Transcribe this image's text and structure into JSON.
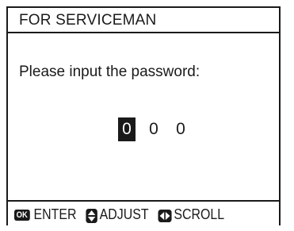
{
  "header": {
    "title": "FOR SERVICEMAN"
  },
  "main": {
    "prompt": "Please input the password:",
    "password_digits": [
      "0",
      "0",
      "0"
    ],
    "selected_digit_index": 0
  },
  "footer": {
    "ok_icon_text": "OK",
    "enter_label": "ENTER",
    "adjust_label": "ADJUST",
    "scroll_label": "SCROLL",
    "icons": [
      "ok-button-icon",
      "up-down-arrow-icon",
      "left-right-arrow-icon"
    ]
  }
}
